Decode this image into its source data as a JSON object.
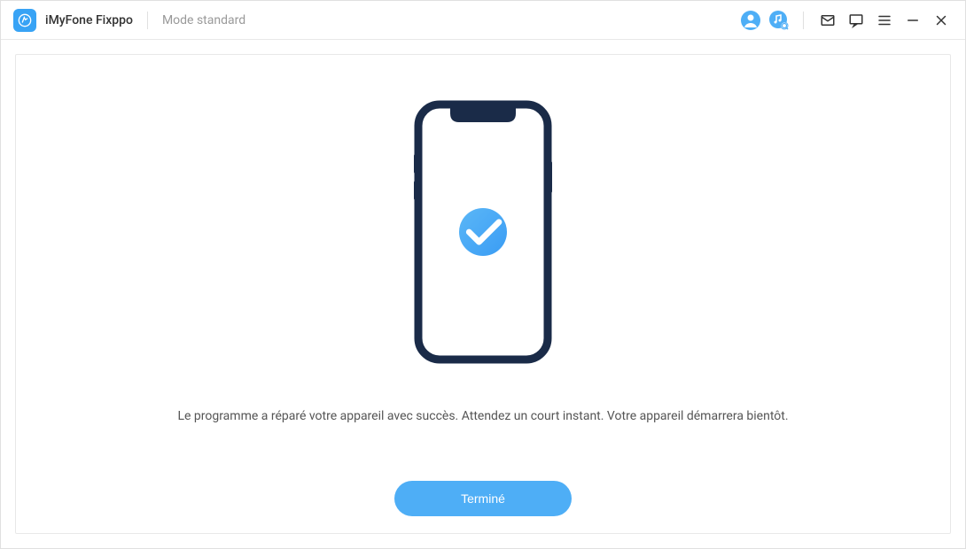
{
  "app": {
    "title": "iMyFone Fixppo",
    "mode": "Mode standard"
  },
  "main": {
    "message": "Le programme a réparé votre appareil avec succès. Attendez un court instant. Votre appareil démarrera bientôt.",
    "doneButton": "Terminé"
  },
  "colors": {
    "primary": "#4eaef6",
    "phoneOutline": "#1a2b48"
  }
}
